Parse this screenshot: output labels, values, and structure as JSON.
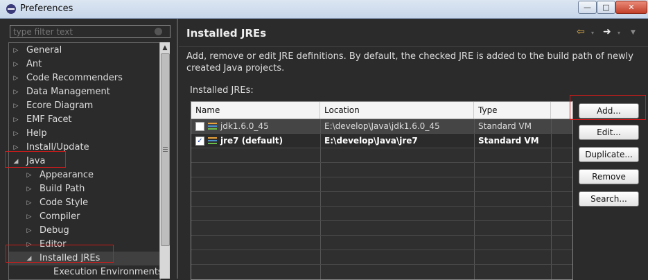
{
  "window": {
    "title": "Preferences",
    "close_glyph": "✕",
    "min_glyph": "—",
    "max_glyph": "□"
  },
  "filter": {
    "placeholder": "type filter text"
  },
  "tree": {
    "items": [
      {
        "label": "General",
        "expanded": false,
        "level": 0
      },
      {
        "label": "Ant",
        "expanded": false,
        "level": 0
      },
      {
        "label": "Code Recommenders",
        "expanded": false,
        "level": 0
      },
      {
        "label": "Data Management",
        "expanded": false,
        "level": 0
      },
      {
        "label": "Ecore Diagram",
        "expanded": false,
        "level": 0
      },
      {
        "label": "EMF Facet",
        "expanded": false,
        "level": 0
      },
      {
        "label": "Help",
        "expanded": false,
        "level": 0
      },
      {
        "label": "Install/Update",
        "expanded": false,
        "level": 0
      },
      {
        "label": "Java",
        "expanded": true,
        "level": 0
      },
      {
        "label": "Appearance",
        "expanded": false,
        "level": 1
      },
      {
        "label": "Build Path",
        "expanded": false,
        "level": 1
      },
      {
        "label": "Code Style",
        "expanded": false,
        "level": 1
      },
      {
        "label": "Compiler",
        "expanded": false,
        "level": 1
      },
      {
        "label": "Debug",
        "expanded": false,
        "level": 1
      },
      {
        "label": "Editor",
        "expanded": false,
        "level": 1
      },
      {
        "label": "Installed JREs",
        "expanded": true,
        "level": 1,
        "selected": true
      },
      {
        "label": "Execution Environments",
        "expanded": false,
        "level": 2
      }
    ]
  },
  "page": {
    "title": "Installed JREs",
    "description": "Add, remove or edit JRE definitions. By default, the checked JRE is added to the build path of newly created Java projects.",
    "table_label": "Installed JREs:",
    "nav": {
      "back": "⇦",
      "forward": "➜",
      "dropdown": "▾",
      "menu": "▼"
    }
  },
  "table": {
    "columns": [
      "Name",
      "Location",
      "Type"
    ],
    "rows": [
      {
        "checked": false,
        "name": "jdk1.6.0_45",
        "location": "E:\\develop\\Java\\jdk1.6.0_45",
        "type": "Standard VM"
      },
      {
        "checked": true,
        "name": "jre7 (default)",
        "location": "E:\\develop\\Java\\jre7",
        "type": "Standard VM"
      }
    ],
    "check_glyph": "✓"
  },
  "buttons": {
    "add": "Add...",
    "edit": "Edit...",
    "duplicate": "Duplicate...",
    "remove": "Remove",
    "search": "Search..."
  },
  "colors": {
    "highlight": "#d01a1a",
    "background": "#2b2b2b",
    "jre_icon": [
      "#e8a33a",
      "#4a8ec8",
      "#6abf4b"
    ]
  }
}
